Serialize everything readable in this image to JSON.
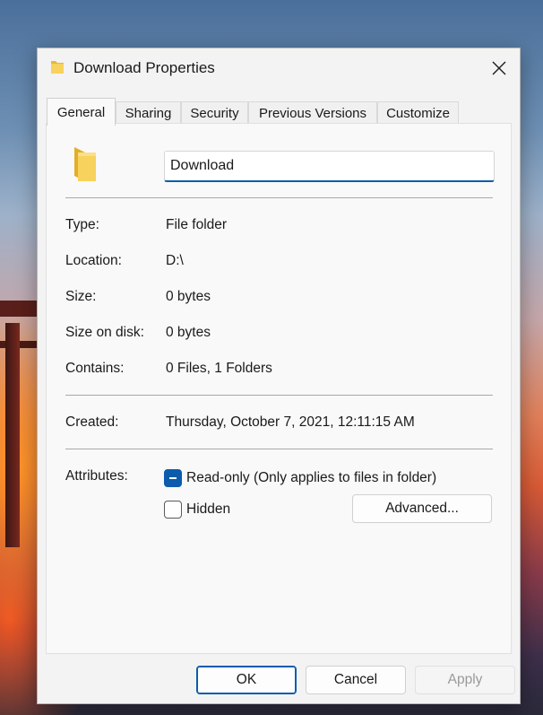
{
  "window": {
    "title": "Download Properties"
  },
  "tabs": [
    {
      "label": "General",
      "active": true
    },
    {
      "label": "Sharing",
      "active": false
    },
    {
      "label": "Security",
      "active": false
    },
    {
      "label": "Previous Versions",
      "active": false
    },
    {
      "label": "Customize",
      "active": false
    }
  ],
  "general": {
    "folder_name": "Download",
    "properties": [
      {
        "label": "Type:",
        "value": "File folder"
      },
      {
        "label": "Location:",
        "value": "D:\\"
      },
      {
        "label": "Size:",
        "value": "0 bytes"
      },
      {
        "label": "Size on disk:",
        "value": "0 bytes"
      },
      {
        "label": "Contains:",
        "value": "0 Files, 1 Folders"
      }
    ],
    "created": {
      "label": "Created:",
      "value": "Thursday, October 7, 2021, 12:11:15 AM"
    },
    "attributes": {
      "label": "Attributes:",
      "readonly_label": "Read-only (Only applies to files in folder)",
      "readonly_state": "indeterminate",
      "hidden_label": "Hidden",
      "hidden_state": "unchecked",
      "advanced_label": "Advanced..."
    }
  },
  "footer": {
    "ok_label": "OK",
    "cancel_label": "Cancel",
    "apply_label": "Apply"
  },
  "colors": {
    "accent": "#0b5cad",
    "folder_yellow": "#f2c94c"
  },
  "icons": {
    "title_icon": "folder-icon",
    "close_icon": "close-icon",
    "large_icon": "folder-icon"
  }
}
